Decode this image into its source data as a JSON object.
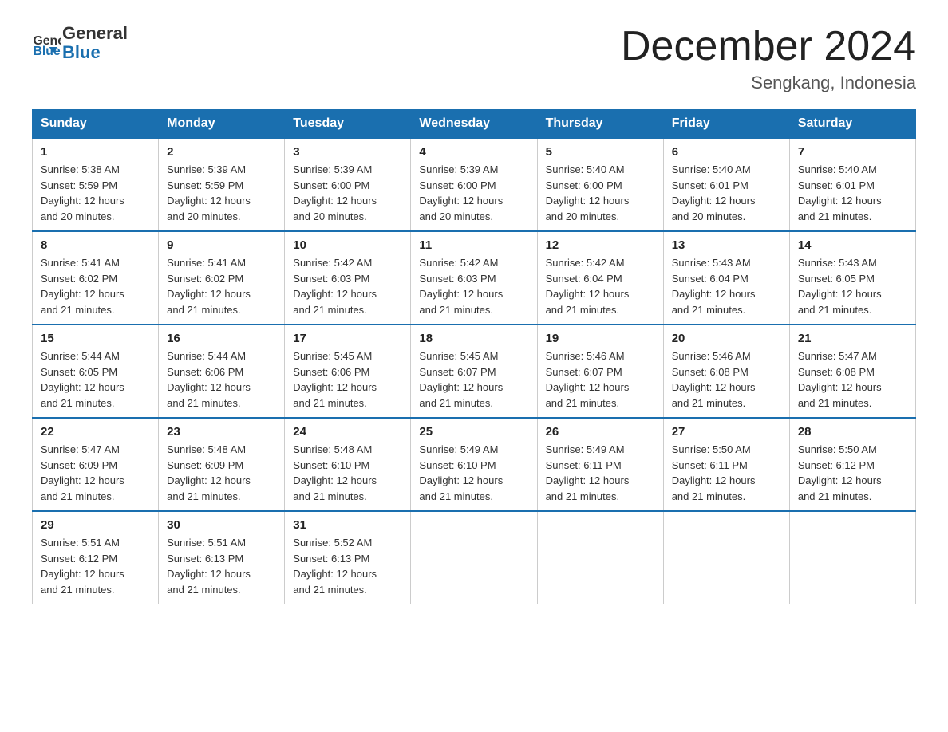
{
  "logo": {
    "line1": "General",
    "line2": "Blue"
  },
  "title": "December 2024",
  "subtitle": "Sengkang, Indonesia",
  "days_of_week": [
    "Sunday",
    "Monday",
    "Tuesday",
    "Wednesday",
    "Thursday",
    "Friday",
    "Saturday"
  ],
  "weeks": [
    [
      {
        "day": "1",
        "sunrise": "5:38 AM",
        "sunset": "5:59 PM",
        "daylight": "12 hours and 20 minutes."
      },
      {
        "day": "2",
        "sunrise": "5:39 AM",
        "sunset": "5:59 PM",
        "daylight": "12 hours and 20 minutes."
      },
      {
        "day": "3",
        "sunrise": "5:39 AM",
        "sunset": "6:00 PM",
        "daylight": "12 hours and 20 minutes."
      },
      {
        "day": "4",
        "sunrise": "5:39 AM",
        "sunset": "6:00 PM",
        "daylight": "12 hours and 20 minutes."
      },
      {
        "day": "5",
        "sunrise": "5:40 AM",
        "sunset": "6:00 PM",
        "daylight": "12 hours and 20 minutes."
      },
      {
        "day": "6",
        "sunrise": "5:40 AM",
        "sunset": "6:01 PM",
        "daylight": "12 hours and 20 minutes."
      },
      {
        "day": "7",
        "sunrise": "5:40 AM",
        "sunset": "6:01 PM",
        "daylight": "12 hours and 21 minutes."
      }
    ],
    [
      {
        "day": "8",
        "sunrise": "5:41 AM",
        "sunset": "6:02 PM",
        "daylight": "12 hours and 21 minutes."
      },
      {
        "day": "9",
        "sunrise": "5:41 AM",
        "sunset": "6:02 PM",
        "daylight": "12 hours and 21 minutes."
      },
      {
        "day": "10",
        "sunrise": "5:42 AM",
        "sunset": "6:03 PM",
        "daylight": "12 hours and 21 minutes."
      },
      {
        "day": "11",
        "sunrise": "5:42 AM",
        "sunset": "6:03 PM",
        "daylight": "12 hours and 21 minutes."
      },
      {
        "day": "12",
        "sunrise": "5:42 AM",
        "sunset": "6:04 PM",
        "daylight": "12 hours and 21 minutes."
      },
      {
        "day": "13",
        "sunrise": "5:43 AM",
        "sunset": "6:04 PM",
        "daylight": "12 hours and 21 minutes."
      },
      {
        "day": "14",
        "sunrise": "5:43 AM",
        "sunset": "6:05 PM",
        "daylight": "12 hours and 21 minutes."
      }
    ],
    [
      {
        "day": "15",
        "sunrise": "5:44 AM",
        "sunset": "6:05 PM",
        "daylight": "12 hours and 21 minutes."
      },
      {
        "day": "16",
        "sunrise": "5:44 AM",
        "sunset": "6:06 PM",
        "daylight": "12 hours and 21 minutes."
      },
      {
        "day": "17",
        "sunrise": "5:45 AM",
        "sunset": "6:06 PM",
        "daylight": "12 hours and 21 minutes."
      },
      {
        "day": "18",
        "sunrise": "5:45 AM",
        "sunset": "6:07 PM",
        "daylight": "12 hours and 21 minutes."
      },
      {
        "day": "19",
        "sunrise": "5:46 AM",
        "sunset": "6:07 PM",
        "daylight": "12 hours and 21 minutes."
      },
      {
        "day": "20",
        "sunrise": "5:46 AM",
        "sunset": "6:08 PM",
        "daylight": "12 hours and 21 minutes."
      },
      {
        "day": "21",
        "sunrise": "5:47 AM",
        "sunset": "6:08 PM",
        "daylight": "12 hours and 21 minutes."
      }
    ],
    [
      {
        "day": "22",
        "sunrise": "5:47 AM",
        "sunset": "6:09 PM",
        "daylight": "12 hours and 21 minutes."
      },
      {
        "day": "23",
        "sunrise": "5:48 AM",
        "sunset": "6:09 PM",
        "daylight": "12 hours and 21 minutes."
      },
      {
        "day": "24",
        "sunrise": "5:48 AM",
        "sunset": "6:10 PM",
        "daylight": "12 hours and 21 minutes."
      },
      {
        "day": "25",
        "sunrise": "5:49 AM",
        "sunset": "6:10 PM",
        "daylight": "12 hours and 21 minutes."
      },
      {
        "day": "26",
        "sunrise": "5:49 AM",
        "sunset": "6:11 PM",
        "daylight": "12 hours and 21 minutes."
      },
      {
        "day": "27",
        "sunrise": "5:50 AM",
        "sunset": "6:11 PM",
        "daylight": "12 hours and 21 minutes."
      },
      {
        "day": "28",
        "sunrise": "5:50 AM",
        "sunset": "6:12 PM",
        "daylight": "12 hours and 21 minutes."
      }
    ],
    [
      {
        "day": "29",
        "sunrise": "5:51 AM",
        "sunset": "6:12 PM",
        "daylight": "12 hours and 21 minutes."
      },
      {
        "day": "30",
        "sunrise": "5:51 AM",
        "sunset": "6:13 PM",
        "daylight": "12 hours and 21 minutes."
      },
      {
        "day": "31",
        "sunrise": "5:52 AM",
        "sunset": "6:13 PM",
        "daylight": "12 hours and 21 minutes."
      },
      null,
      null,
      null,
      null
    ]
  ],
  "labels": {
    "sunrise": "Sunrise:",
    "sunset": "Sunset:",
    "daylight": "Daylight:"
  }
}
